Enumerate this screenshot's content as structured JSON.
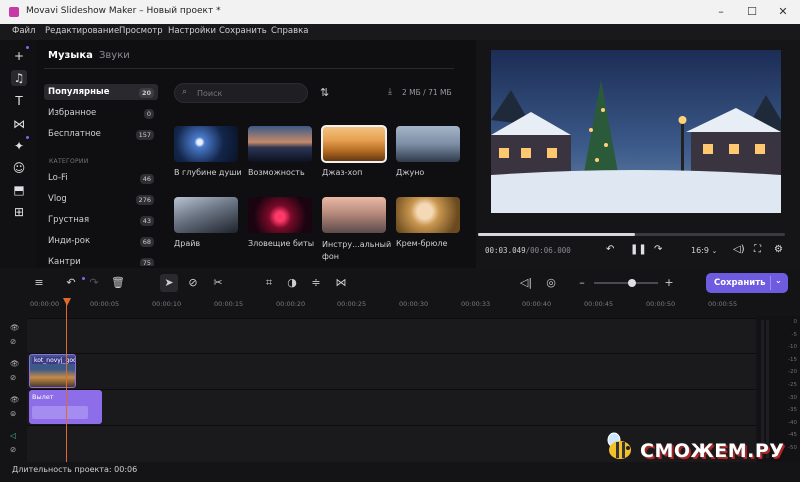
{
  "window": {
    "title": "Movavi Slideshow Maker – Новый проект *",
    "minimize": "–",
    "maximize": "☐",
    "close": "✕"
  },
  "menu": [
    "Файл",
    "Редактирование",
    "Просмотр",
    "Настройки",
    "Сохранить",
    "Справка"
  ],
  "tools": [
    {
      "icon": "plus-icon",
      "glyph": "+"
    },
    {
      "icon": "music-note-icon",
      "glyph": "♫"
    },
    {
      "icon": "text-icon",
      "glyph": "T"
    },
    {
      "icon": "transitions-icon",
      "glyph": "⋈"
    },
    {
      "icon": "magic-wand-icon",
      "glyph": "✦"
    },
    {
      "icon": "sticker-icon",
      "glyph": "☺"
    },
    {
      "icon": "media-icon",
      "glyph": "⬒"
    },
    {
      "icon": "grid-icon",
      "glyph": "⊞"
    }
  ],
  "tabs": {
    "music": "Музыка",
    "sounds": "Звуки"
  },
  "categories": [
    {
      "label": "Популярные",
      "count": "20"
    },
    {
      "label": "Избранное",
      "count": "0"
    },
    {
      "label": "Бесплатное",
      "count": "157"
    }
  ],
  "categories_section": "КАТЕГОРИИ",
  "genres": [
    {
      "label": "Lo-Fi",
      "count": "46"
    },
    {
      "label": "Vlog",
      "count": "276"
    },
    {
      "label": "Грустная",
      "count": "43"
    },
    {
      "label": "Инди-рок",
      "count": "68"
    },
    {
      "label": "Кантри",
      "count": "75"
    }
  ],
  "search": {
    "placeholder": "Поиск",
    "icon": "search-icon"
  },
  "storage": "2 МБ / 71 МБ",
  "tracks_row1": [
    "В глубине души",
    "Возможность",
    "Джаз-хоп",
    "Джуно"
  ],
  "tracks_row2": [
    "Драйв",
    "Зловещие биты",
    "Инстру...альный фон",
    "Крем-брюле"
  ],
  "colors": {
    "accent": "#6d5ce0",
    "clip_purple": "#8d6ee8",
    "playhead": "#e06a2a"
  },
  "player": {
    "time_current": "00:03.049",
    "time_total": "00:06.000",
    "aspect": "16:9",
    "progress": 0.51
  },
  "ruler": [
    "00:00:00",
    "00:00:05",
    "00:00:10",
    "00:00:15",
    "00:00:20",
    "00:00:25",
    "00:00:30",
    "00:00:33",
    "00:00:40",
    "00:00:45",
    "00:00:50",
    "00:00:55"
  ],
  "clips": {
    "image": "kot_novyj_god",
    "title": "Вылет"
  },
  "save_button": "Сохранить",
  "status": "Длительность проекта: 00:06",
  "meter_labels": [
    "0",
    "-5",
    "-10",
    "-15",
    "-20",
    "-25",
    "-30",
    "-35",
    "-40",
    "-45",
    "-50"
  ],
  "watermark": "СМОЖЕМ.РУ"
}
